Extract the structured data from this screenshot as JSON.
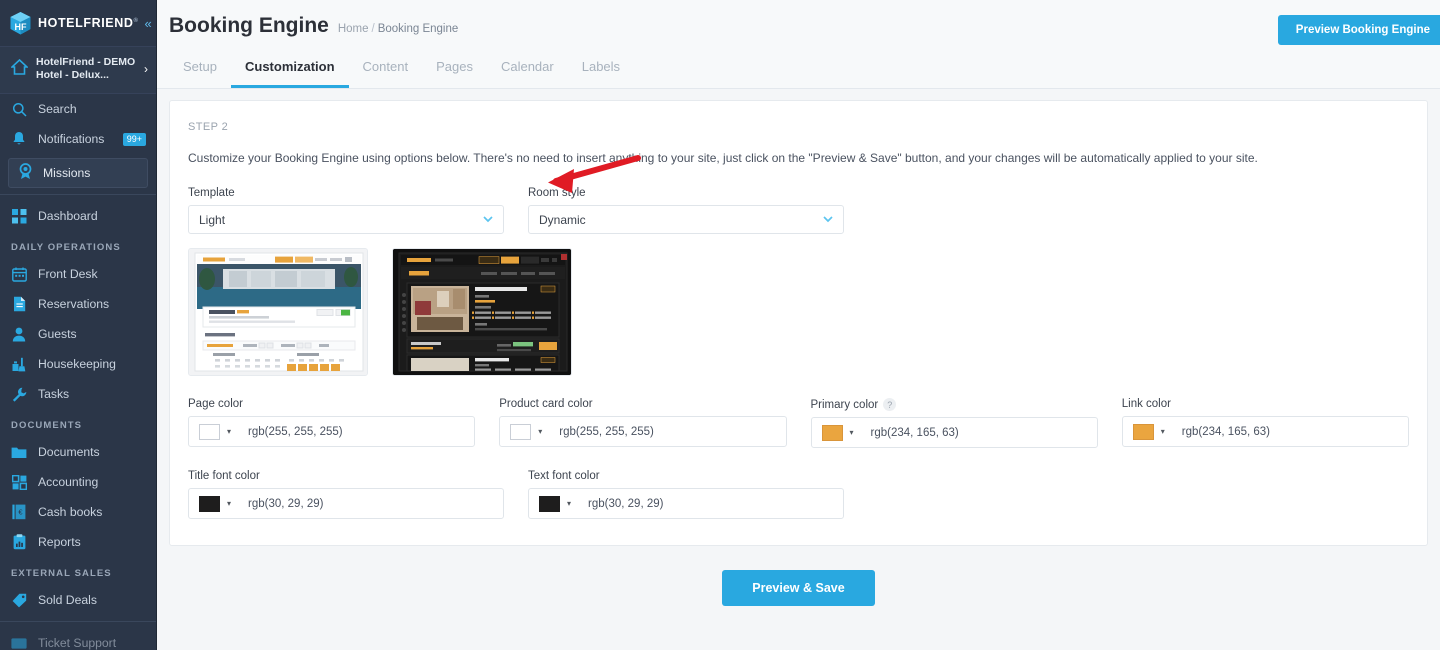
{
  "sidebar": {
    "brand": {
      "name": "HOTELFRIEND",
      "reg": "®",
      "collapse_icon": "«"
    },
    "hotel": {
      "name": "HotelFriend - DEMO Hotel - Delux...",
      "chevron": "›"
    },
    "quick": [
      {
        "label": "Search",
        "icon": "search-icon",
        "badge": ""
      },
      {
        "label": "Notifications",
        "icon": "bell-icon",
        "badge": "99+"
      }
    ],
    "missions": {
      "label": "Missions",
      "icon": "award-icon"
    },
    "dashboard": {
      "label": "Dashboard",
      "icon": "grid-icon"
    },
    "groups": [
      {
        "title": "DAILY OPERATIONS",
        "items": [
          {
            "label": "Front Desk",
            "icon": "calendar-icon"
          },
          {
            "label": "Reservations",
            "icon": "document-icon"
          },
          {
            "label": "Guests",
            "icon": "person-icon"
          },
          {
            "label": "Housekeeping",
            "icon": "broom-icon"
          },
          {
            "label": "Tasks",
            "icon": "wrench-icon"
          }
        ]
      },
      {
        "title": "DOCUMENTS",
        "items": [
          {
            "label": "Documents",
            "icon": "folder-icon"
          },
          {
            "label": "Accounting",
            "icon": "calculator-icon"
          },
          {
            "label": "Cash books",
            "icon": "cashbook-icon"
          },
          {
            "label": "Reports",
            "icon": "clipboard-icon"
          }
        ]
      },
      {
        "title": "EXTERNAL SALES",
        "items": [
          {
            "label": "Sold Deals",
            "icon": "tag-icon"
          },
          {
            "label": "Ticket Support",
            "icon": "ticket-icon"
          }
        ]
      }
    ]
  },
  "header": {
    "title": "Booking Engine",
    "breadcrumb_home": "Home",
    "breadcrumb_sep": "/",
    "breadcrumb_current": "Booking Engine",
    "preview_button": "Preview Booking Engine"
  },
  "tabs": [
    {
      "label": "Setup",
      "active": false
    },
    {
      "label": "Customization",
      "active": true
    },
    {
      "label": "Content",
      "active": false
    },
    {
      "label": "Pages",
      "active": false
    },
    {
      "label": "Calendar",
      "active": false
    },
    {
      "label": "Labels",
      "active": false
    }
  ],
  "card": {
    "step": "STEP 2",
    "intro": "Customize your Booking Engine using options below. There's no need to insert anything to your site, just click on the \"Preview & Save\" button, and your changes will be automatically applied to your site.",
    "selects": [
      {
        "label": "Template",
        "value": "Light",
        "chevron": "⌄"
      },
      {
        "label": "Room style",
        "value": "Dynamic",
        "chevron": "⌄"
      }
    ],
    "colors_row1": [
      {
        "label": "Page color",
        "value": "rgb(255, 255, 255)",
        "swatch": "#ffffff",
        "caret": "▾",
        "help": ""
      },
      {
        "label": "Product card color",
        "value": "rgb(255, 255, 255)",
        "swatch": "#ffffff",
        "caret": "▾",
        "help": ""
      },
      {
        "label": "Primary color",
        "value": "rgb(234, 165, 63)",
        "swatch": "#eaa53f",
        "caret": "▾",
        "help": "?"
      },
      {
        "label": "Link color",
        "value": "rgb(234, 165, 63)",
        "swatch": "#eaa53f",
        "caret": "▾",
        "help": ""
      }
    ],
    "colors_row2": [
      {
        "label": "Title font color",
        "value": "rgb(30, 29, 29)",
        "swatch": "#1e1d1d",
        "caret": "▾",
        "help": ""
      },
      {
        "label": "Text font color",
        "value": "rgb(30, 29, 29)",
        "swatch": "#1e1d1d",
        "caret": "▾",
        "help": ""
      }
    ],
    "save_button": "Preview & Save"
  },
  "theme": {
    "accent": "#29a8e0",
    "sidebar_bg": "#2b3648",
    "page_bg": "#f4f6f8",
    "annotation_color": "#e01b24"
  }
}
